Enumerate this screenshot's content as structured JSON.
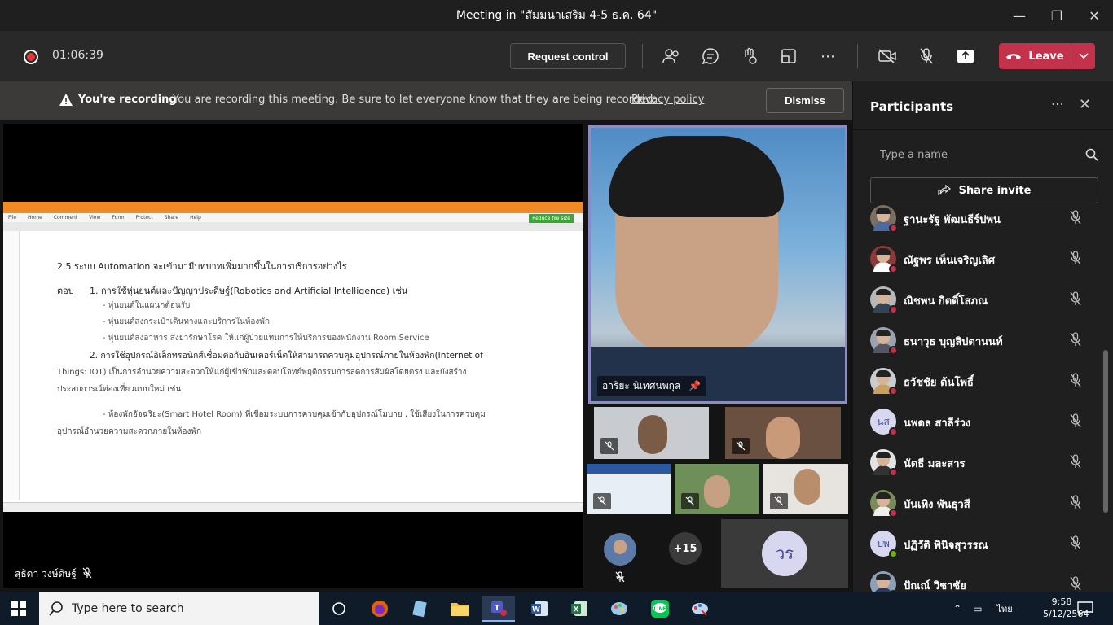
{
  "window": {
    "title": "Meeting in \"สัมมนาเสริม 4-5 ธ.ค. 64\"",
    "minimize_icon": "minimize-icon",
    "maximize_icon": "maximize-icon",
    "close_icon": "close-icon"
  },
  "toolbar": {
    "elapsed": "01:06:39",
    "request_control": "Request control",
    "leave": "Leave",
    "accent": "#c4314b"
  },
  "banner": {
    "heading": "You're recording",
    "message": "You are recording this meeting. Be sure to let everyone know that they are being recorded.",
    "link": "Privacy policy",
    "dismiss": "Dismiss"
  },
  "shared_doc": {
    "menu": [
      "File",
      "Home",
      "Comment",
      "View",
      "Form",
      "Protect",
      "Share",
      "Help"
    ],
    "reduce_label": "Reduce file size",
    "lines": [
      "2.5 ระบบ Automation จะเข้ามามีบทบาทเพิ่มมากขึ้นในการบริการอย่างไร",
      "ตอบ",
      "1. การใช้หุ่นยนต์และปัญญาประดิษฐ์(Robotics and Artificial Intelligence) เช่น",
      "- หุ่นยนต์ในแผนกต้อนรับ",
      "- หุ่นยนต์ส่งกระเป๋าเดินทางและบริการในห้องพัก",
      "- หุ่นยนต์ส่งอาหาร ส่งยารักษาโรค ให้แก่ผู้ป่วยแทนการให้บริการของพนักงาน Room Service",
      "2. การใช้อุปกรณ์อิเล็กทรอนิกส์เชื่อมต่อกับอินเตอร์เน็ตให้สามารถควบคุมอุปกรณ์ภายในห้องพัก(Internet of",
      "Things: IOT) เป็นการอำนวยความสะดวกให้แก่ผู้เข้าพักและตอบโจทย์พฤติกรรมการลดการสัมผัสโดยตรง และยังสร้าง",
      "ประสบการณ์ท่องเที่ยวแบบใหม่ เช่น",
      "- ห้องพักอัจฉริยะ(Smart Hotel Room) ที่เชื่อมระบบการควบคุมเข้ากับอุปกรณ์โมบาย , ใช้เสียงในการควบคุม",
      "อุปกรณ์อำนวยความสะดวกภายในห้องพัก"
    ]
  },
  "presenter": {
    "name": "สุธิดา วงษ์ดิษฐ์"
  },
  "pinned": {
    "name": "อาริยะ นิเทศนพกุล"
  },
  "gallery": {
    "overflow": "+15",
    "initials": "วร"
  },
  "participants": {
    "title": "Participants",
    "search_placeholder": "Type a name",
    "share_invite": "Share invite",
    "list": [
      {
        "name": "ฐานะรัฐ พัฒนธีร์ปพน",
        "status": "busy"
      },
      {
        "name": "ณัฐพร เห็นเจริญเลิศ",
        "status": "busy"
      },
      {
        "name": "ณิชพน กิตติ์โสภณ",
        "status": "busy"
      },
      {
        "name": "ธนาวุธ บุญลิปตานนท์",
        "status": "busy"
      },
      {
        "name": "ธวัชชัย ต้นโพธิ์",
        "status": "busy"
      },
      {
        "name": "นพดล สาลีร่วง",
        "status": "busy",
        "initials": "นส"
      },
      {
        "name": "นัดธี มละสาร",
        "status": "busy"
      },
      {
        "name": "บันเทิง พันธุวสี",
        "status": "busy"
      },
      {
        "name": "ปฏิวัติ พินิจสุวรรณ",
        "status": "available",
        "initials": "ปพ"
      },
      {
        "name": "ปัณณ์ วิชาชัย",
        "status": "busy"
      }
    ]
  },
  "taskbar": {
    "search_placeholder": "Type here to search",
    "language": "ไทย",
    "time": "9:58",
    "date": "5/12/2564"
  }
}
